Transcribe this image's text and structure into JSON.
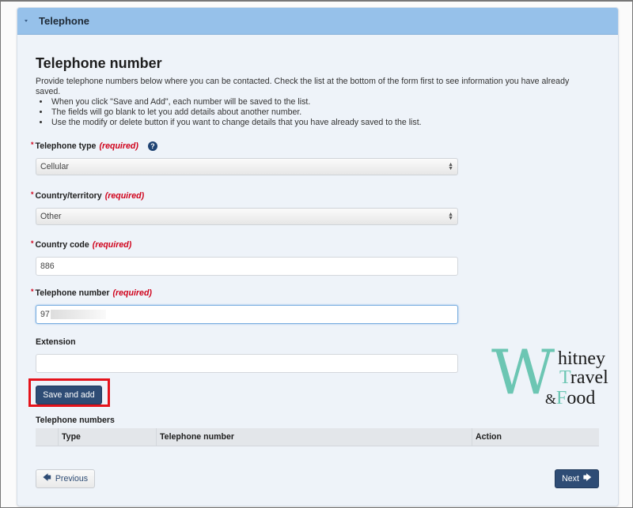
{
  "panel": {
    "title": "Telephone",
    "collapse_icon": "caret-down-icon"
  },
  "section": {
    "heading": "Telephone number",
    "intro": "Provide telephone numbers below where you can be contacted. Check the list at the bottom of the form first to see information you have already saved.",
    "bullets": [
      "When you click \"Save and Add\", each number will be saved to the list.",
      "The fields will go blank to let you add details about another number.",
      "Use the modify or delete button if you want to change details that you have already saved to the list."
    ]
  },
  "form": {
    "required_marker": "*",
    "required_text": "(required)",
    "telephone_type": {
      "label": "Telephone type",
      "value": "Cellular",
      "help_icon": "?"
    },
    "country": {
      "label": "Country/territory",
      "value": "Other"
    },
    "country_code": {
      "label": "Country code",
      "value": "886"
    },
    "telephone_number": {
      "label": "Telephone number",
      "value": "97"
    },
    "extension": {
      "label": "Extension",
      "value": ""
    },
    "save_button": "Save and add"
  },
  "table": {
    "title": "Telephone numbers",
    "columns": [
      "",
      "Type",
      "Telephone number",
      "Action"
    ],
    "rows": []
  },
  "nav": {
    "previous": "Previous",
    "previous_icon": "🡄",
    "next": "Next",
    "next_icon": "🡆"
  },
  "watermark": {
    "letter": "W",
    "line1": "hitney",
    "line2_first": "T",
    "line2_rest": "ravel",
    "line3_amp": "&",
    "line3_first": "F",
    "line3_rest": "ood"
  },
  "colors": {
    "header_bg": "#96c1ea",
    "primary_button": "#2e4c75",
    "required": "#d0021b",
    "highlight_box": "#e5131b",
    "watermark_teal": "#6cc6b3"
  }
}
